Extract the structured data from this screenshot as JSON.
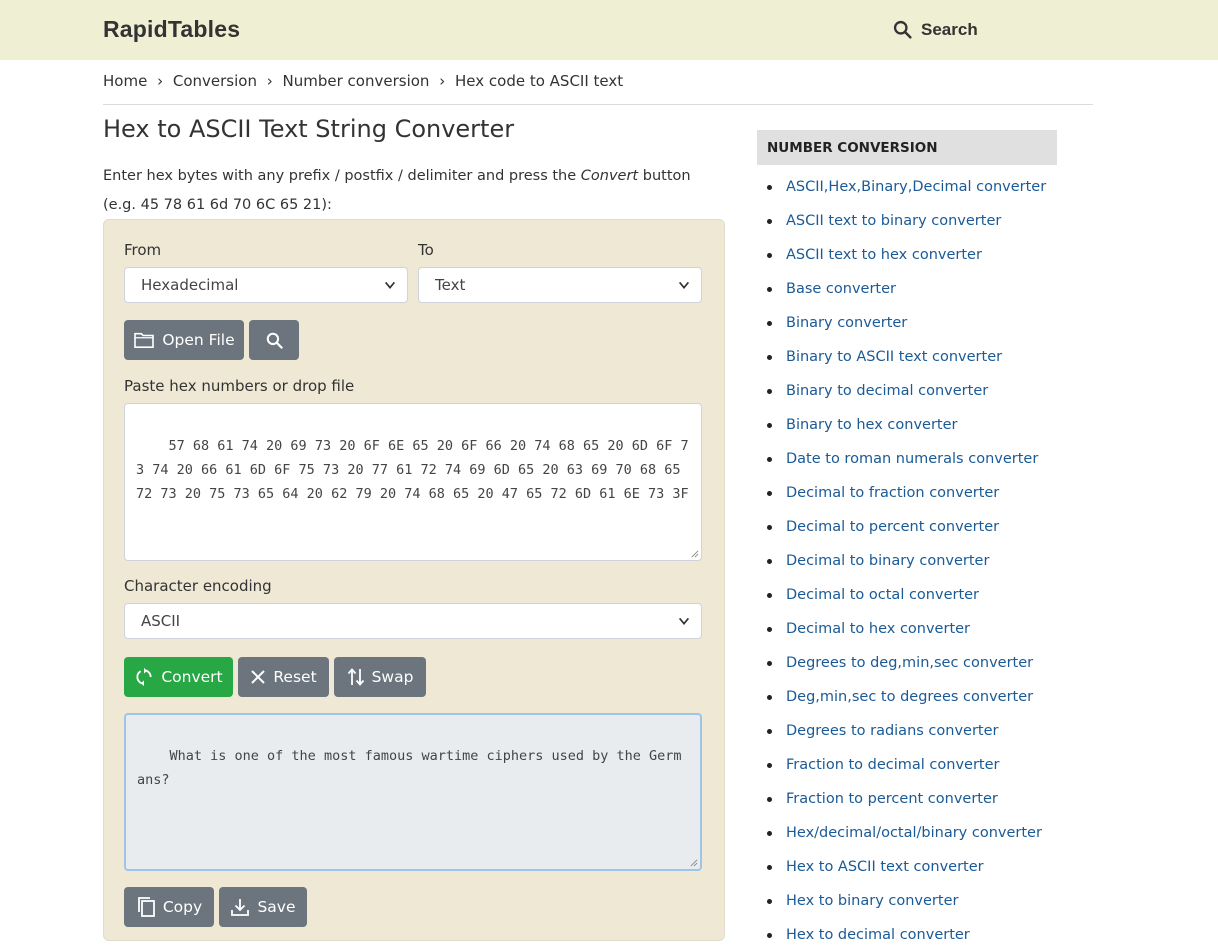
{
  "header": {
    "logo": "RapidTables",
    "search_label": "Search"
  },
  "breadcrumb": {
    "items": [
      "Home",
      "Conversion",
      "Number conversion",
      "Hex code to ASCII text"
    ],
    "separator": "›"
  },
  "page": {
    "title": "Hex to ASCII Text String Converter",
    "intro_before": "Enter hex bytes with any prefix / postfix / delimiter and press the ",
    "intro_em": "Convert",
    "intro_after": " button",
    "intro_example": "(e.g. 45 78 61 6d 70 6C 65 21):"
  },
  "converter": {
    "from_label": "From",
    "from_value": "Hexadecimal",
    "to_label": "To",
    "to_value": "Text",
    "open_file_label": "Open File",
    "input_label": "Paste hex numbers or drop file",
    "input_value": "57 68 61 74 20 69 73 20 6F 6E 65 20 6F 66 20 74 68 65 20 6D 6F 73 74 20 66 61 6D 6F 75 73 20 77 61 72 74 69 6D 65 20 63 69 70 68 65 72 73 20 75 73 65 64 20 62 79 20 74 68 65 20 47 65 72 6D 61 6E 73 3F",
    "encoding_label": "Character encoding",
    "encoding_value": "ASCII",
    "convert_label": "Convert",
    "reset_label": "Reset",
    "swap_label": "Swap",
    "output_value": "What is one of the most famous wartime ciphers used by the Germans?",
    "copy_label": "Copy",
    "save_label": "Save"
  },
  "sidebar": {
    "heading": "NUMBER CONVERSION",
    "items": [
      "ASCII,Hex,Binary,Decimal converter",
      "ASCII text to binary converter",
      "ASCII text to hex converter",
      "Base converter",
      "Binary converter",
      "Binary to ASCII text converter",
      "Binary to decimal converter",
      "Binary to hex converter",
      "Date to roman numerals converter",
      "Decimal to fraction converter",
      "Decimal to percent converter",
      "Decimal to binary converter",
      "Decimal to octal converter",
      "Decimal to hex converter",
      "Degrees to deg,min,sec converter",
      "Deg,min,sec to degrees converter",
      "Degrees to radians converter",
      "Fraction to decimal converter",
      "Fraction to percent converter",
      "Hex/decimal/octal/binary converter",
      "Hex to ASCII text converter",
      "Hex to binary converter",
      "Hex to decimal converter"
    ]
  },
  "colors": {
    "header_bg": "#efefd4",
    "panel_bg": "#eee8d5",
    "link": "#1a5a96",
    "button_gray": "#6c757d",
    "button_green": "#28a745"
  }
}
